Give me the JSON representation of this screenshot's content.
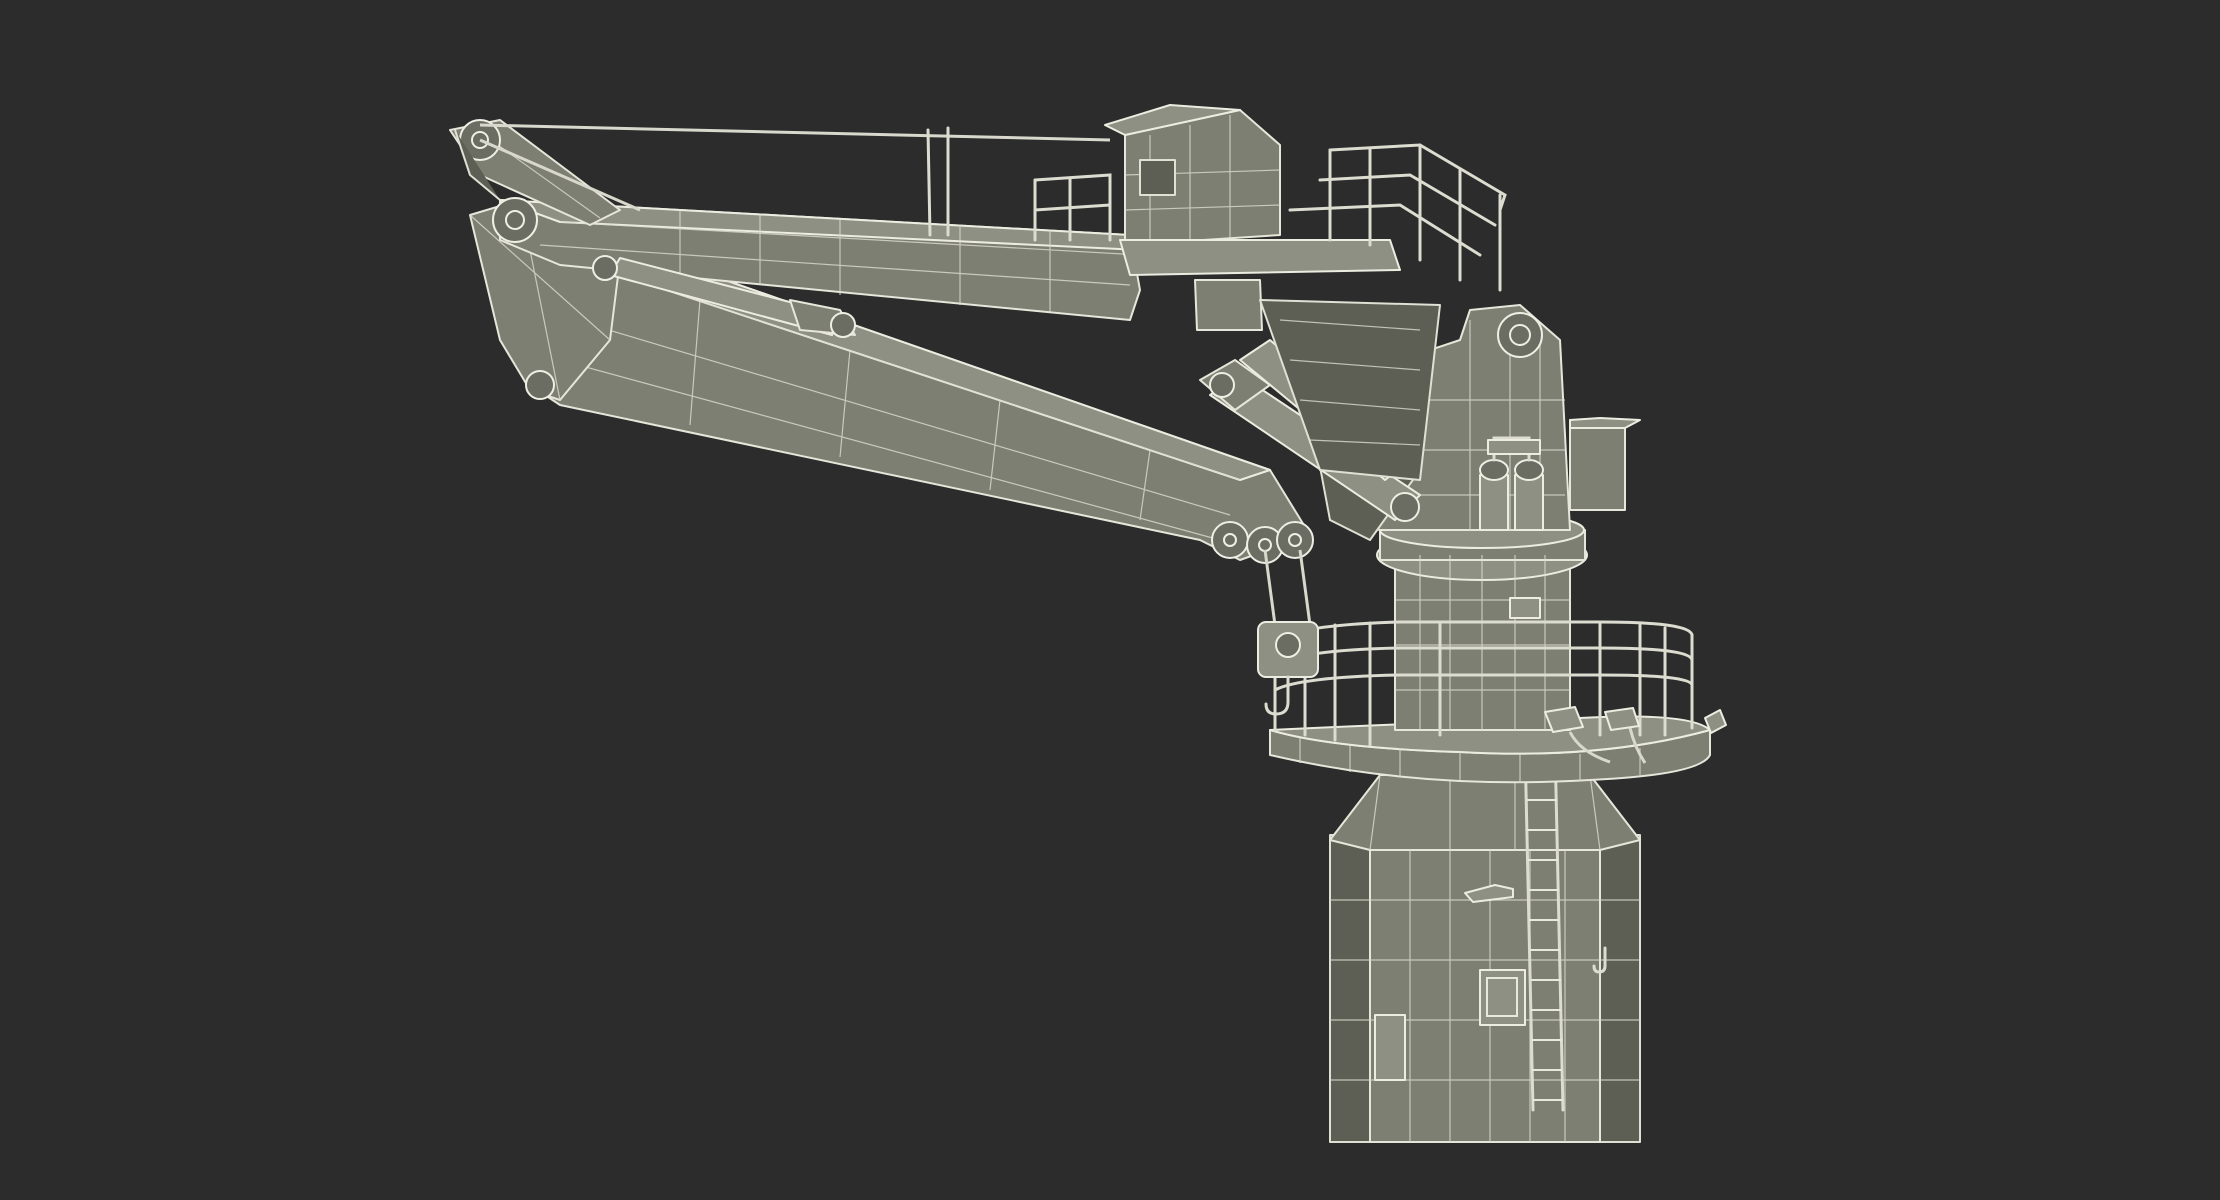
{
  "scene": {
    "background_color": "#2b2c2b",
    "model_fill_color": "#7d7f72",
    "wire_color": "#e6e6da",
    "render_style": "wireframe-on-shaded"
  },
  "labels": {
    "door_sign": "",
    "panel_sign": ""
  }
}
